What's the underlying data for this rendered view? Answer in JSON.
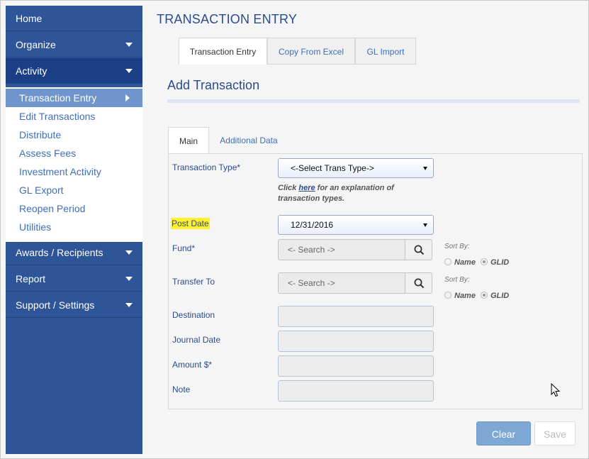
{
  "sidebar": {
    "items": [
      {
        "label": "Home"
      },
      {
        "label": "Organize"
      },
      {
        "label": "Activity"
      }
    ],
    "submenu": [
      {
        "label": "Transaction Entry"
      },
      {
        "label": "Edit Transactions"
      },
      {
        "label": "Distribute"
      },
      {
        "label": "Assess Fees"
      },
      {
        "label": "Investment Activity"
      },
      {
        "label": "GL Export"
      },
      {
        "label": "Reopen Period"
      },
      {
        "label": "Utilities"
      }
    ],
    "bottom_items": [
      {
        "label": "Awards / Recipients"
      },
      {
        "label": "Report"
      },
      {
        "label": "Support / Settings"
      }
    ]
  },
  "page": {
    "title": "TRANSACTION ENTRY",
    "tabs": [
      {
        "label": "Transaction Entry"
      },
      {
        "label": "Copy From Excel"
      },
      {
        "label": "GL Import"
      }
    ],
    "section_title": "Add Transaction"
  },
  "form": {
    "tabs": [
      {
        "label": "Main"
      },
      {
        "label": "Additional Data"
      }
    ],
    "transaction_type": {
      "label": "Transaction Type*",
      "value": "<-Select Trans Type->",
      "help_prefix": "Click ",
      "help_link": "here",
      "help_suffix": " for an explanation of transaction types."
    },
    "post_date": {
      "label": "Post Date",
      "value": "12/31/2016"
    },
    "fund": {
      "label": "Fund*",
      "placeholder": "<- Search ->"
    },
    "transfer_to": {
      "label": "Transfer To",
      "placeholder": "<- Search ->"
    },
    "sort_by": {
      "label": "Sort By:",
      "option_name": "Name",
      "option_glid": "GLID"
    },
    "destination": {
      "label": "Destination",
      "value": ""
    },
    "journal_date": {
      "label": "Journal Date",
      "value": ""
    },
    "amount": {
      "label": "Amount $*",
      "value": ""
    },
    "note": {
      "label": "Note",
      "value": ""
    },
    "highlight_color": "#fff22a"
  },
  "buttons": {
    "clear": "Clear",
    "save": "Save"
  },
  "colors": {
    "sidebar": "#2e5597",
    "active_nav": "#1a3f86",
    "active_sub": "#6f95cc",
    "title": "#2a4c8d"
  }
}
